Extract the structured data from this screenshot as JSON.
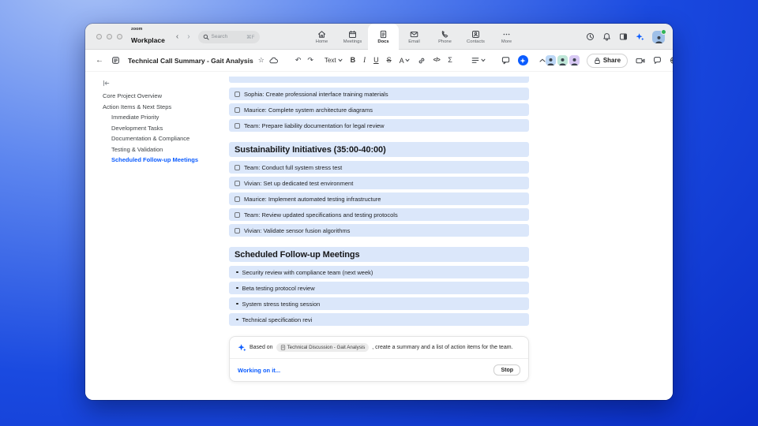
{
  "topbar": {
    "logo_small": "zoom",
    "logo_text": "Workplace",
    "search": {
      "placeholder": "Search",
      "shortcut": "⌘F"
    },
    "tabs": [
      {
        "label": "Home",
        "icon": "home-icon",
        "active": false
      },
      {
        "label": "Meetings",
        "icon": "calendar-icon",
        "active": false
      },
      {
        "label": "Docs",
        "icon": "doc-icon",
        "active": true
      },
      {
        "label": "Email",
        "icon": "email-icon",
        "active": false
      },
      {
        "label": "Phone",
        "icon": "phone-icon",
        "active": false
      },
      {
        "label": "Contacts",
        "icon": "contacts-icon",
        "active": false
      },
      {
        "label": "More",
        "icon": "more-icon",
        "active": false
      }
    ]
  },
  "doc_toolbar": {
    "title": "Technical Call Summary - Gait Analysis",
    "text_style": "Text",
    "bold": "B",
    "italic": "I",
    "underline": "U",
    "strikethrough": "S",
    "text_color": "A",
    "code": "</>",
    "formula": "Σ",
    "share": "Share",
    "collaborators": [
      {
        "name": "collaborator-1",
        "color": "#bcd7f6"
      },
      {
        "name": "collaborator-2",
        "color": "#bfe7d8"
      },
      {
        "name": "collaborator-3",
        "color": "#d8c9f4"
      }
    ]
  },
  "icons": {
    "back": "←",
    "nav_back": "‹",
    "nav_forward": "›",
    "undo": "↶",
    "redo": "↷",
    "star": "☆",
    "more_horizontal": "⋯"
  },
  "outline": {
    "items": [
      {
        "label": "Core Project Overview",
        "level": 1,
        "active": false
      },
      {
        "label": "Action Items & Next Steps",
        "level": 1,
        "active": false
      },
      {
        "label": "Immediate Priority",
        "level": 2,
        "active": false
      },
      {
        "label": "Development Tasks",
        "level": 2,
        "active": false
      },
      {
        "label": "Documentation & Compliance",
        "level": 2,
        "active": false
      },
      {
        "label": "Testing & Validation",
        "level": 2,
        "active": false
      },
      {
        "label": "Scheduled Follow-up Meetings",
        "level": 2,
        "active": true
      }
    ]
  },
  "document": {
    "blocks": [
      {
        "type": "partial",
        "text": ""
      },
      {
        "type": "todo",
        "text": "Sophia: Create professional interface training materials"
      },
      {
        "type": "todo",
        "text": "Maurice: Complete system architecture diagrams"
      },
      {
        "type": "todo",
        "text": "Team: Prepare liability documentation for legal review"
      },
      {
        "type": "heading",
        "text": "Sustainability Initiatives (35:00-40:00)"
      },
      {
        "type": "todo",
        "text": "Team: Conduct full system stress test"
      },
      {
        "type": "todo",
        "text": "Vivian: Set up dedicated test environment"
      },
      {
        "type": "todo",
        "text": "Maurice: Implement automated testing infrastructure"
      },
      {
        "type": "todo",
        "text": "Team: Review updated specifications and testing protocols"
      },
      {
        "type": "todo",
        "text": "Vivian: Validate sensor fusion algorithms"
      },
      {
        "type": "heading",
        "text": "Scheduled Follow-up Meetings"
      },
      {
        "type": "bullet",
        "text": "Security review with compliance team (next week)"
      },
      {
        "type": "bullet",
        "text": "Beta testing protocol review"
      },
      {
        "type": "bullet",
        "text": "System stress testing session"
      },
      {
        "type": "bullet",
        "text": "Technical specification revi"
      }
    ]
  },
  "ai_panel": {
    "prefix": "Based on",
    "chip_label": "Technical Discussion - Gait Analysis",
    "suffix": ", create a summary and a list of action items for the team.",
    "status": "Working on it...",
    "stop": "Stop"
  },
  "colors": {
    "accent_blue": "#0b5cff",
    "row_highlight": "#dbe7fa",
    "topbar_gray": "#ebeced",
    "background_gradient_start": "#a9c2f6",
    "background_gradient_end": "#0a2ec8",
    "presence_green": "#2fb457"
  }
}
